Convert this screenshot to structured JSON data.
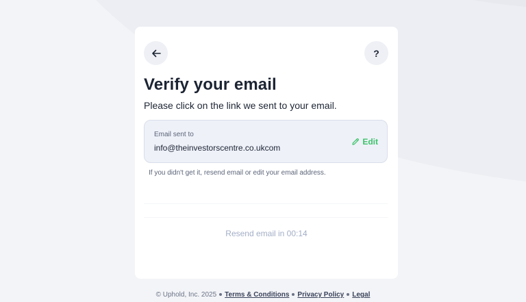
{
  "header": {
    "back_icon": "arrow-left-icon",
    "help_label": "?"
  },
  "main": {
    "title": "Verify your email",
    "subtitle": "Please click on the link we sent to your email.",
    "email_box": {
      "label": "Email sent to",
      "email": "info@theinvestorscentre.co.ukcom",
      "edit_label": "Edit",
      "edit_icon": "pencil-icon"
    },
    "hint": "If you didn't get it, resend email or edit your email address.",
    "resend_label": "Resend email in 00:14"
  },
  "footer": {
    "copyright": "© Uphold, Inc. 2025",
    "links": [
      "Terms & Conditions",
      "Privacy Policy",
      "Legal"
    ]
  },
  "colors": {
    "background": "#f3f4f7",
    "card": "#ffffff",
    "accent_green": "#3ec26b",
    "text_dark": "#1c2433",
    "muted": "#a3aec6"
  }
}
